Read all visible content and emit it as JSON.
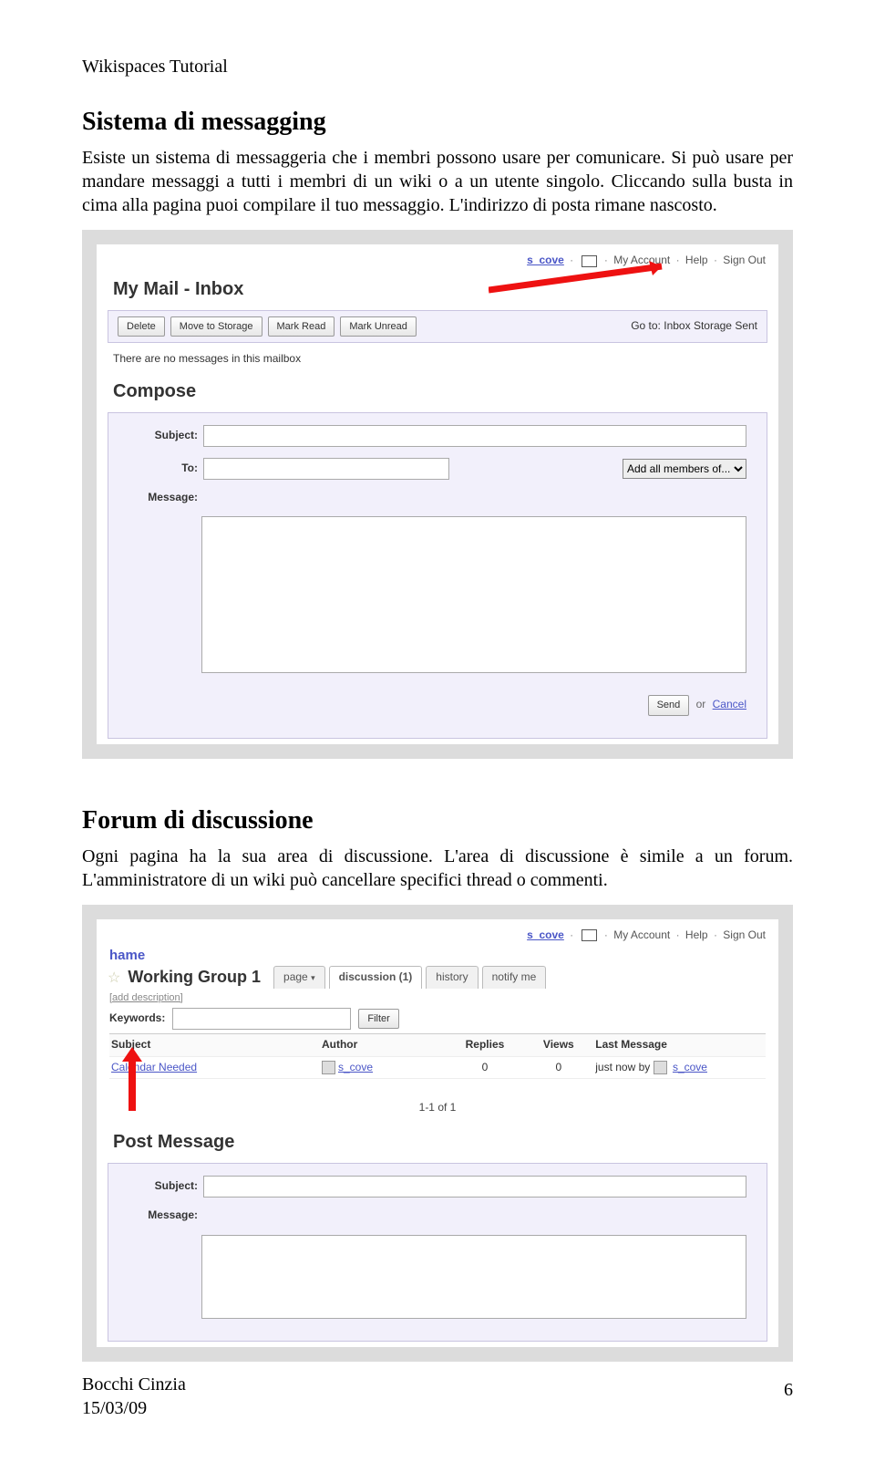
{
  "doc": {
    "header": "Wikispaces Tutorial",
    "h1": "Sistema di messagging",
    "p1": "Esiste un sistema di messaggeria che i membri possono usare per comunicare. Si può usare per mandare messaggi a tutti i membri di un wiki o a un utente singolo. Cliccando sulla busta in cima alla pagina puoi compilare il tuo messaggio. L'indirizzo di posta rimane nascosto.",
    "h2": "Forum di discussione",
    "p2": "Ogni pagina ha la sua area di discussione. L'area di discussione è simile a un forum. L'amministratore di un wiki può cancellare specifici thread o commenti.",
    "footer_author": "Bocchi Cinzia",
    "footer_date": "15/03/09",
    "page_number": "6"
  },
  "toplinks": {
    "user": "s_cove",
    "account": "My Account",
    "help": "Help",
    "signout": "Sign Out"
  },
  "mail": {
    "title": "My Mail - Inbox",
    "btn_delete": "Delete",
    "btn_move": "Move to Storage",
    "btn_read": "Mark Read",
    "btn_unread": "Mark Unread",
    "goto_label": "Go to:",
    "goto_inbox": "Inbox",
    "goto_storage": "Storage",
    "goto_sent": "Sent",
    "empty": "There are no messages in this mailbox",
    "compose": "Compose",
    "lbl_subject": "Subject:",
    "lbl_to": "To:",
    "lbl_message": "Message:",
    "addall": "Add all members of...",
    "send": "Send",
    "or": "or",
    "cancel": "Cancel"
  },
  "forum": {
    "hame": "hame",
    "title": "Working Group 1",
    "tab_page": "page",
    "tab_disc": "discussion (1)",
    "tab_hist": "history",
    "tab_notify": "notify me",
    "adddesc": "[add description]",
    "kw_label": "Keywords:",
    "filter": "Filter",
    "col_subject": "Subject",
    "col_author": "Author",
    "col_replies": "Replies",
    "col_views": "Views",
    "col_last": "Last Message",
    "row_subject": "Calendar Needed",
    "row_author": "s_cove",
    "row_replies": "0",
    "row_views": "0",
    "row_last_prefix": "just now by",
    "row_last_user": "s_cove",
    "pager": "1-1 of 1",
    "post_title": "Post Message",
    "lbl_subject": "Subject:",
    "lbl_message": "Message:"
  }
}
